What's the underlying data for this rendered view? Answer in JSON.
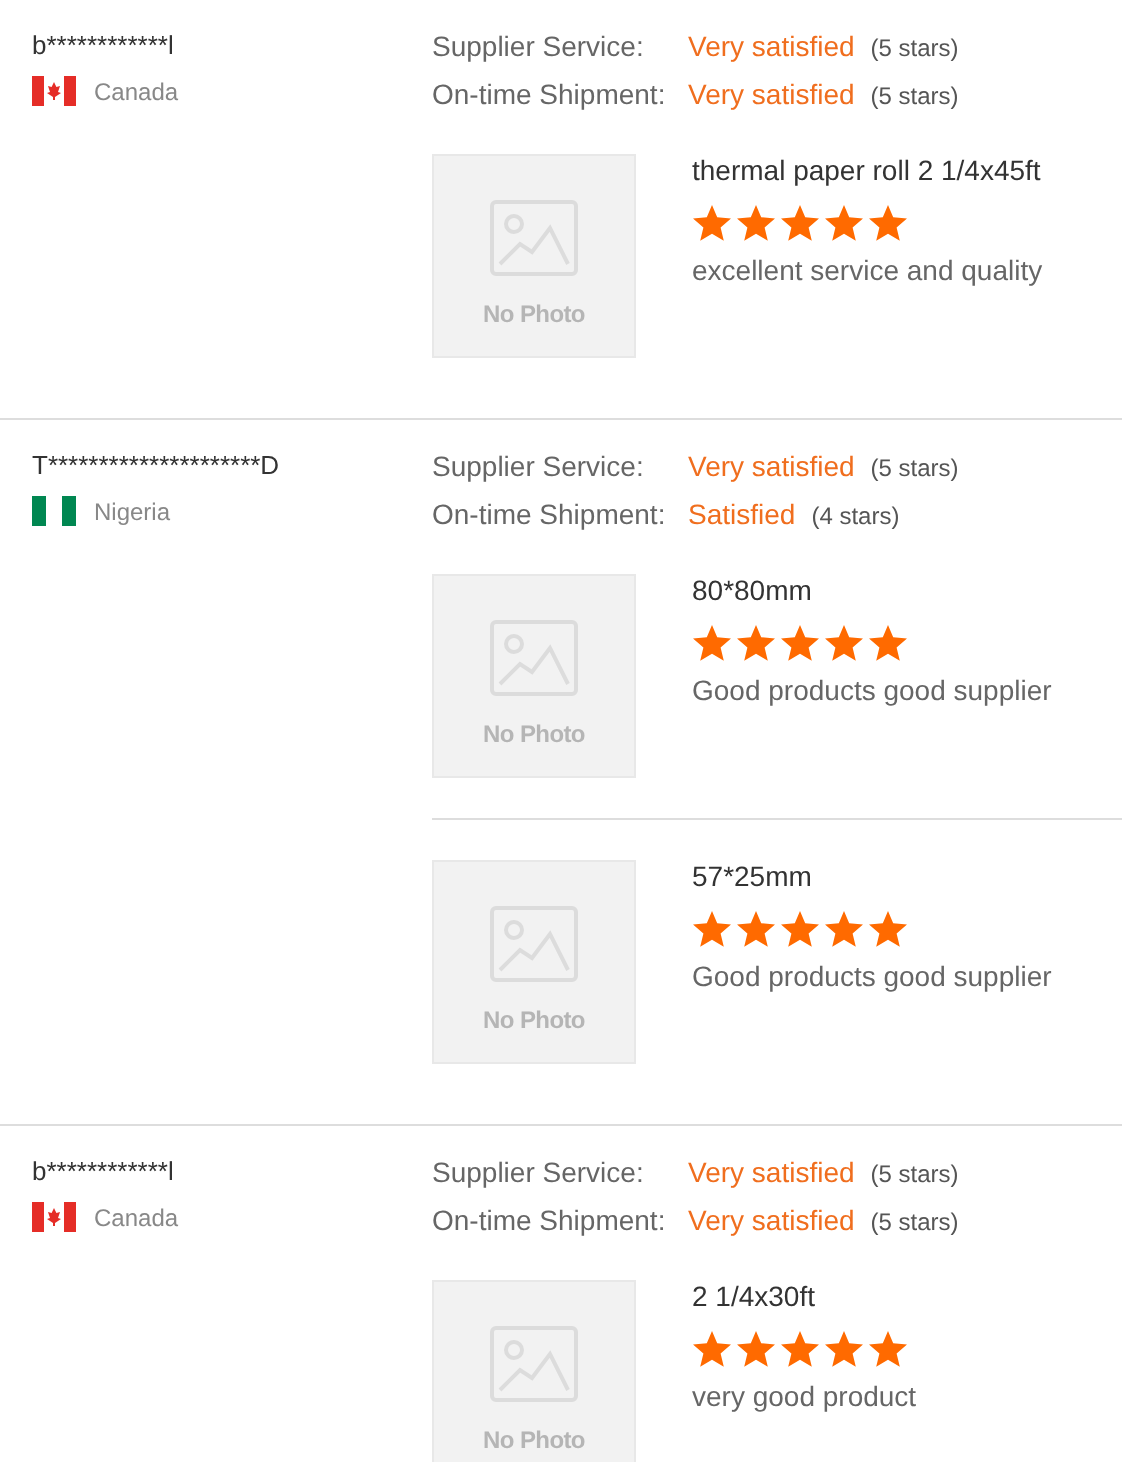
{
  "reviews": [
    {
      "buyer": "b************l",
      "kind": "ca",
      "country": "Canada",
      "ratings": [
        {
          "label": "Supplier Service:",
          "verdict": "Very satisfied",
          "count": "(5 stars)"
        },
        {
          "label": "On-time Shipment:",
          "verdict": "Very satisfied",
          "count": "(5 stars)"
        }
      ],
      "products": [
        {
          "image_label": "No Photo",
          "title": "thermal paper roll 2 1/4x45ft",
          "stars": 5,
          "comment": "excellent service and quality"
        }
      ]
    },
    {
      "buyer": "T*********************D",
      "kind": "ng",
      "country": "Nigeria",
      "ratings": [
        {
          "label": "Supplier Service:",
          "verdict": "Very satisfied",
          "count": "(5 stars)"
        },
        {
          "label": "On-time Shipment:",
          "verdict": "Satisfied",
          "count": "(4 stars)"
        }
      ],
      "products": [
        {
          "image_label": "No Photo",
          "title": "80*80mm",
          "stars": 5,
          "comment": "Good products good supplier"
        },
        {
          "image_label": "No Photo",
          "title": "57*25mm",
          "stars": 5,
          "comment": "Good products good supplier"
        }
      ]
    },
    {
      "buyer": "b************l",
      "kind": "ca",
      "country": "Canada",
      "ratings": [
        {
          "label": "Supplier Service:",
          "verdict": "Very satisfied",
          "count": "(5 stars)"
        },
        {
          "label": "On-time Shipment:",
          "verdict": "Very satisfied",
          "count": "(5 stars)"
        }
      ],
      "products": [
        {
          "image_label": "No Photo",
          "title": "2 1/4x30ft",
          "stars": 5,
          "comment": "very good product"
        }
      ]
    }
  ]
}
